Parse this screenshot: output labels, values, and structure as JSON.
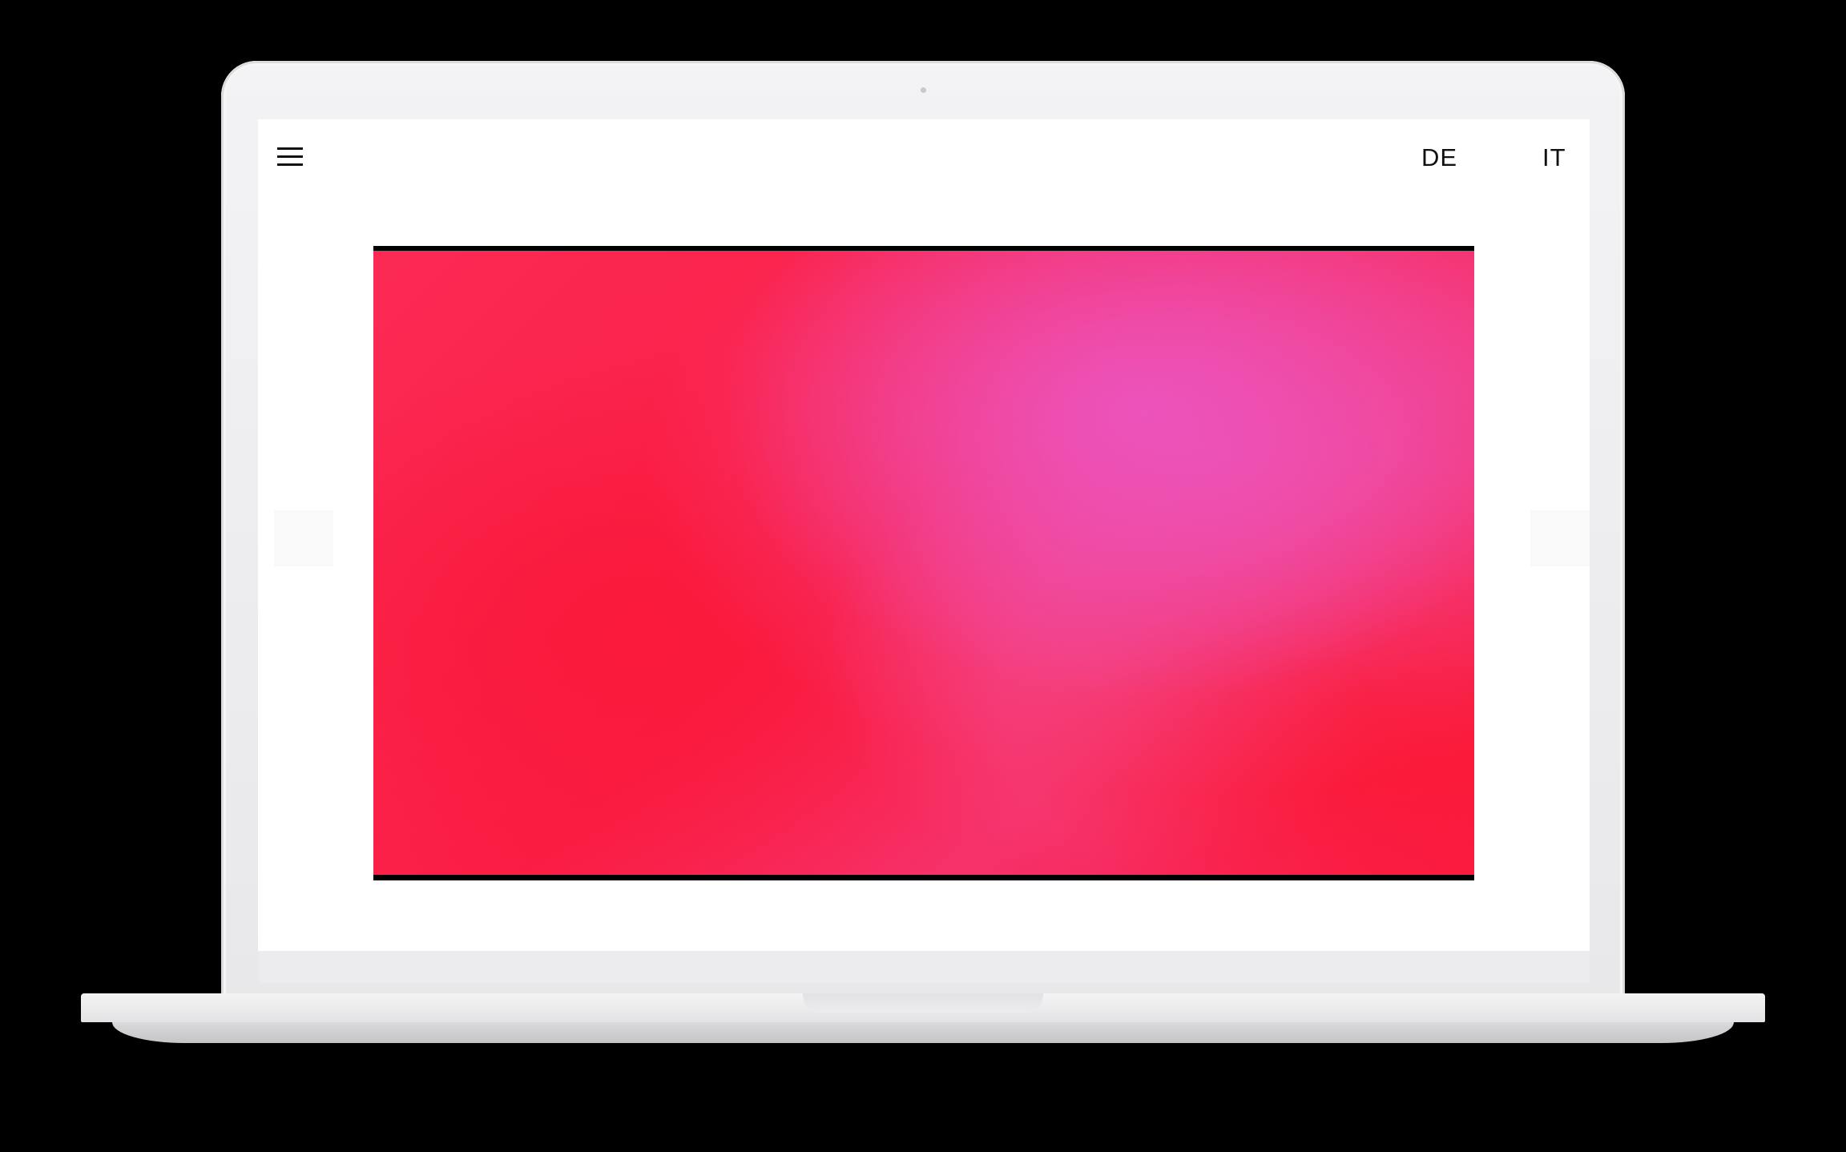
{
  "header": {
    "menu_icon": "hamburger-menu-icon",
    "languages": [
      "DE",
      "IT"
    ]
  },
  "hero": {
    "colors": {
      "primary": "#fa1e45",
      "secondary": "#ec54be"
    }
  },
  "device": {
    "frame_color": "#ebebed",
    "background": "#000000"
  }
}
